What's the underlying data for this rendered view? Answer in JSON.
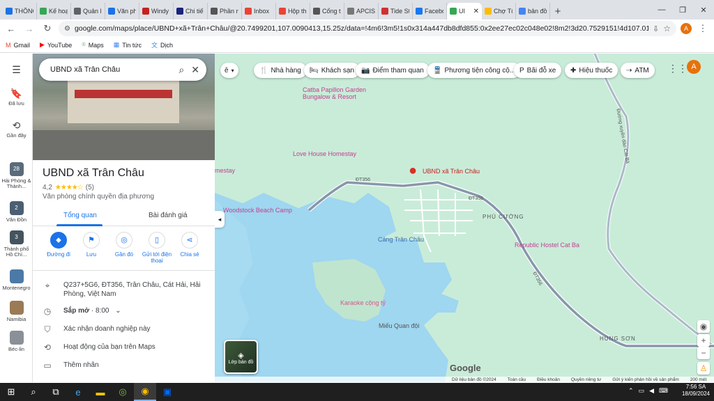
{
  "browser": {
    "tabs": [
      {
        "label": "THÔNG",
        "color": "#1a73e8"
      },
      {
        "label": "Kế hoạ",
        "color": "#34a853"
      },
      {
        "label": "Quản l",
        "color": "#5f6368"
      },
      {
        "label": "Văn ph",
        "color": "#1a73e8"
      },
      {
        "label": "Windy",
        "color": "#c5221f"
      },
      {
        "label": "Chi tiế",
        "color": "#1a237e"
      },
      {
        "label": "Phần n",
        "color": "#555555"
      },
      {
        "label": "Inbox",
        "color": "#ea4335"
      },
      {
        "label": "Hộp th",
        "color": "#ea4335"
      },
      {
        "label": "Cổng t",
        "color": "#555555"
      },
      {
        "label": "APCIS",
        "color": "#777777"
      },
      {
        "label": "Tide St",
        "color": "#d32f2f"
      },
      {
        "label": "Facebo",
        "color": "#1877f2"
      },
      {
        "label": "UI",
        "color": "#34a853"
      },
      {
        "label": "Chợ Tố",
        "color": "#fbbc04"
      },
      {
        "label": "bản đồ",
        "color": "#4285f4"
      }
    ],
    "active_tab_index": 13,
    "close_glyph": "✕",
    "new_tab_glyph": "+",
    "url": "google.com/maps/place/UBND+xã+Trân+Châu/@20.7499201,107.0090413,15.25z/data=!4m6!3m5!1s0x314a447db8dfd855:0x2ee27ec02c048e02!8m2!3d20.7529151!4d107.0137635!16s%2Fg%2F11tf2646j?e...",
    "profile_initial": "A",
    "bookmarks": [
      {
        "label": "Gmail",
        "icon": "gmail-icon",
        "glyph": "M",
        "color": "#ea4335"
      },
      {
        "label": "YouTube",
        "icon": "youtube-icon",
        "glyph": "▶",
        "color": "#ff0000"
      },
      {
        "label": "Maps",
        "icon": "maps-pin-icon",
        "glyph": "⌾",
        "color": "#34a853"
      },
      {
        "label": "Tin tức",
        "icon": "news-icon",
        "glyph": "▦",
        "color": "#4285f4"
      },
      {
        "label": "Dịch",
        "icon": "translate-icon",
        "glyph": "文",
        "color": "#4285f4"
      }
    ]
  },
  "rail": {
    "saved": "Đã lưu",
    "recent": "Gần đây",
    "recents": [
      {
        "label": "Hải Phòng & Thành...",
        "badge": "28"
      },
      {
        "label": "Vân Đồn",
        "badge": "2"
      },
      {
        "label": "Thành phố Hồ Chí...",
        "badge": "3"
      },
      {
        "label": "Montenegro",
        "badge": ""
      },
      {
        "label": "Namibia",
        "badge": ""
      },
      {
        "label": "Béc-lin",
        "badge": ""
      }
    ]
  },
  "place": {
    "search_value": "UBND xã Trân Châu",
    "title": "UBND xã Trân Châu",
    "rating": "4,2",
    "stars": "★★★★☆",
    "review_count": "(5)",
    "category": "Văn phòng chính quyền địa phương",
    "tabs": [
      "Tổng quan",
      "Bài đánh giá"
    ],
    "actions": [
      {
        "label": "Đường đi",
        "glyph": "⬥"
      },
      {
        "label": "Lưu",
        "glyph": "⚑"
      },
      {
        "label": "Gần đó",
        "glyph": "◎"
      },
      {
        "label": "Gửi tới điện thoại",
        "glyph": "▯"
      },
      {
        "label": "Chia sẻ",
        "glyph": "⋖"
      }
    ],
    "address": "Q237+5G6, ĐT356, Trân Châu, Cát Hải, Hải Phòng, Việt Nam",
    "hours_status": "Sắp mở",
    "hours_time": " · 8:00",
    "claim": "Xác nhận doanh nghiệp này",
    "activity": "Hoạt động của bạn trên Maps",
    "add_label": "Thêm nhãn"
  },
  "map": {
    "chips": [
      {
        "label": "Nhà hàng",
        "glyph": "🍴"
      },
      {
        "label": "Khách sạn",
        "glyph": "🛏"
      },
      {
        "label": "Điểm tham quan",
        "glyph": "📷"
      },
      {
        "label": "Phương tiện công cộ...",
        "glyph": "🚆"
      },
      {
        "label": "Bãi đỗ xe",
        "glyph": "P"
      },
      {
        "label": "Hiệu thuốc",
        "glyph": "✚"
      },
      {
        "label": "ATM",
        "glyph": "⇢"
      }
    ],
    "layer_label": "Lớp bản đồ",
    "labels": {
      "catba_papillon": "Catba Papillon Garden Bungalow & Resort",
      "love_house": "Love House Homestay",
      "ubnd": "UBND xã Trân Châu",
      "homestay_left": "mestay",
      "woodstock": "Woodstock Beach Camp",
      "phu_cuong": "PHÚ CƯỜNG",
      "cang": "Cảng Trân Châu",
      "republic": "Republic Hostel Cat Ba",
      "karaoke": "Karaoke cộng tỷ",
      "mieu": "Miếu Quan đội",
      "hung_son": "HÙNG SƠN",
      "dt356a": "ĐT356",
      "dt356b": "ĐT356",
      "dt356c": "ĐT356",
      "xuyen_dao": "Đường xuyên đảo Cát Bà"
    },
    "google": "Google",
    "footer": [
      "Dữ liệu bản đồ ©2024",
      "Toàn cầu",
      "Điều khoản",
      "Quyền riêng tư",
      "Gửi ý kiến phản hồi về sản phẩm",
      "200 mét"
    ]
  },
  "taskbar": {
    "time": "7:56 SA",
    "date": "18/09/2024"
  }
}
